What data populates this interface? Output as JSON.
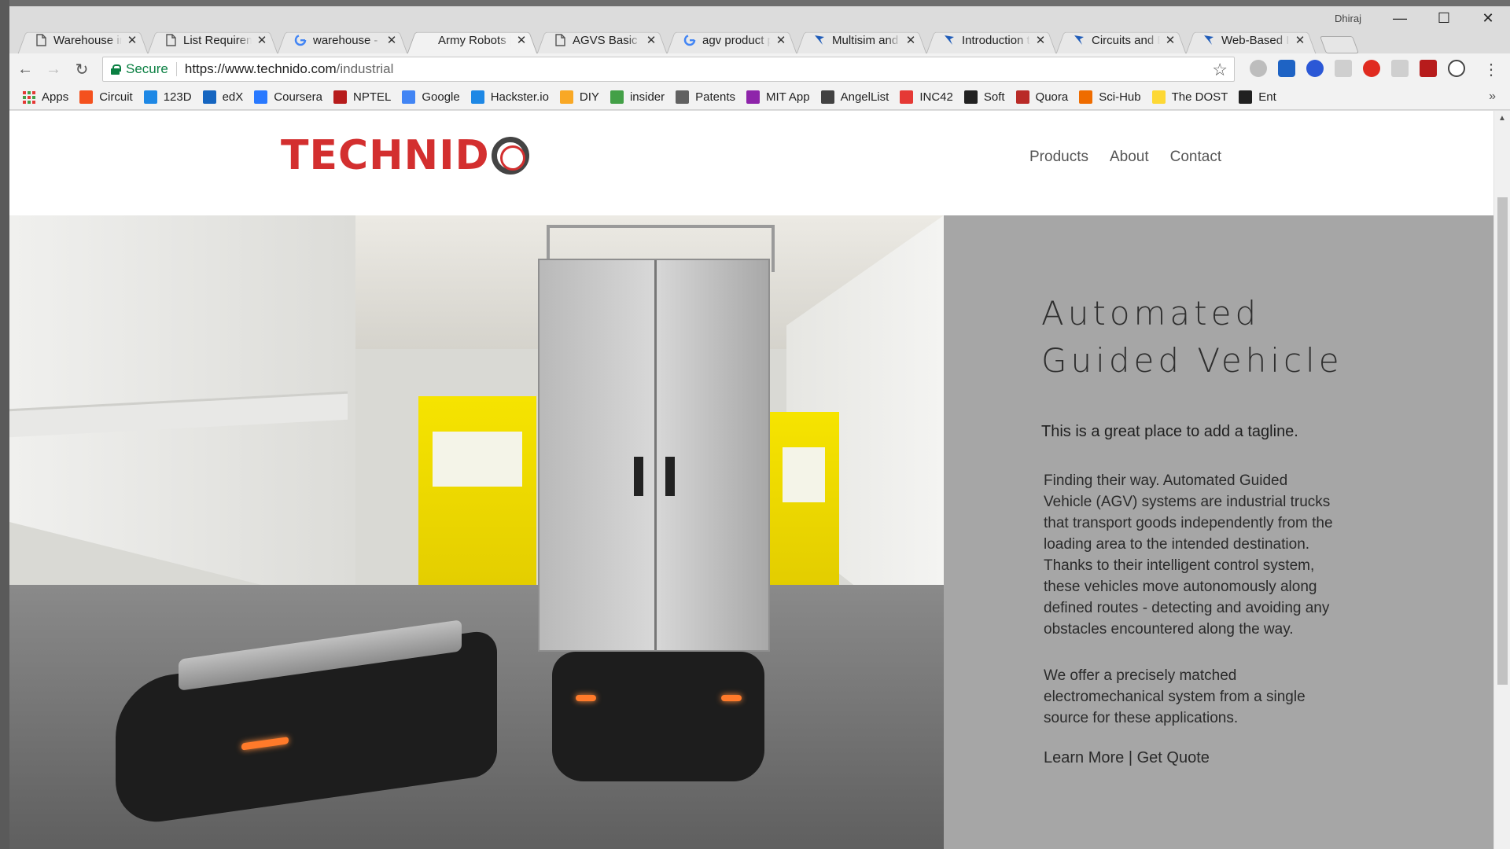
{
  "browser": {
    "profile_name": "Dhiraj",
    "tabs": [
      {
        "label": "Warehouse in",
        "icon": "document-icon",
        "active": false
      },
      {
        "label": "List Requirem",
        "icon": "document-icon",
        "active": false
      },
      {
        "label": "warehouse - G",
        "icon": "google-icon",
        "active": false
      },
      {
        "label": "Army Robots |",
        "icon": "none",
        "active": true
      },
      {
        "label": "AGVS Basic In",
        "icon": "document-icon",
        "active": false
      },
      {
        "label": "agv product p",
        "icon": "google-icon",
        "active": false
      },
      {
        "label": "Multisim and",
        "icon": "ni-icon",
        "active": false
      },
      {
        "label": "Introduction t",
        "icon": "ni-icon",
        "active": false
      },
      {
        "label": "Circuits and E",
        "icon": "ni-icon",
        "active": false
      },
      {
        "label": "Web-Based In",
        "icon": "ni-icon",
        "active": false
      }
    ],
    "close_glyph": "✕",
    "window_controls": {
      "minimize": "—",
      "maximize": "☐",
      "close": "✕"
    },
    "address": {
      "secure_label": "Secure",
      "url_origin": "https://www.technido.com",
      "url_path": "/industrial"
    },
    "bookmarks": [
      {
        "label": "Apps",
        "icon": "apps-grid-icon",
        "color": "#e53935"
      },
      {
        "label": "Circuit",
        "icon": "circuit-icon",
        "color": "#f4511e"
      },
      {
        "label": "123D",
        "icon": "autodesk-icon",
        "color": "#1e88e5"
      },
      {
        "label": "edX",
        "icon": "edx-icon",
        "color": "#1565c0"
      },
      {
        "label": "Coursera",
        "icon": "coursera-icon",
        "color": "#2979ff"
      },
      {
        "label": "NPTEL",
        "icon": "nptel-icon",
        "color": "#b71c1c"
      },
      {
        "label": "Google",
        "icon": "google-icon",
        "color": "#4285f4"
      },
      {
        "label": "Hackster.io",
        "icon": "hackster-icon",
        "color": "#1e88e5"
      },
      {
        "label": "DIY",
        "icon": "diy-icon",
        "color": "#f9a825"
      },
      {
        "label": "insider",
        "icon": "microsoft-icon",
        "color": "#43a047"
      },
      {
        "label": "Patents",
        "icon": "patents-icon",
        "color": "#616161"
      },
      {
        "label": "MIT App",
        "icon": "mit-app-icon",
        "color": "#8e24aa"
      },
      {
        "label": "AngelList",
        "icon": "angellist-icon",
        "color": "#424242"
      },
      {
        "label": "INC42",
        "icon": "inc42-icon",
        "color": "#e53935"
      },
      {
        "label": "Soft",
        "icon": "soft-icon",
        "color": "#212121"
      },
      {
        "label": "Quora",
        "icon": "quora-icon",
        "color": "#b92b27"
      },
      {
        "label": "Sci-Hub",
        "icon": "scihub-icon",
        "color": "#ef6c00"
      },
      {
        "label": "The DOST",
        "icon": "lightbulb-icon",
        "color": "#fdd835"
      },
      {
        "label": "Ent",
        "icon": "ent-icon",
        "color": "#212121"
      }
    ],
    "bookmarks_more": "»"
  },
  "site": {
    "logo_text": "TECHNID",
    "nav": [
      "Products",
      "About",
      "Contact"
    ],
    "hero": {
      "title": "Automated Guided Vehicle",
      "tagline": "This is a great place to add a tagline.",
      "paragraph_1": "Finding their way. Automated Guided Vehicle (AGV) systems are industrial trucks that transport goods independently from the loading area to the intended destination. Thanks to their intelligent control system, these vehicles move autonomously along defined routes - detecting and avoiding any obstacles encountered along the way.",
      "paragraph_2": "We offer a precisely matched electromechanical system from a single source for these applications.",
      "link_learn_more": "Learn More",
      "link_separator": "|",
      "link_get_quote": "Get Quote"
    },
    "colors": {
      "logo_red": "#d32f2f",
      "hero_panel_bg": "#a6a6a6",
      "secure_green": "#0b8043"
    }
  }
}
